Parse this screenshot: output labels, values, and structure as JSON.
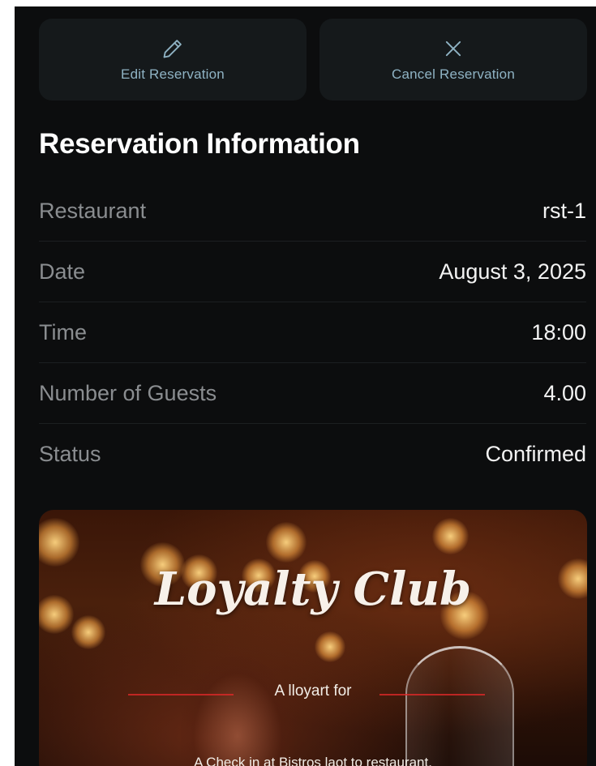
{
  "actions": {
    "edit": {
      "label": "Edit Reservation",
      "icon": "pencil-icon"
    },
    "cancel": {
      "label": "Cancel Reservation",
      "icon": "close-icon"
    }
  },
  "reservation": {
    "title": "Reservation Information",
    "rows": [
      {
        "label": "Restaurant",
        "value": "rst-1"
      },
      {
        "label": "Date",
        "value": "August 3, 2025"
      },
      {
        "label": "Time",
        "value": "18:00"
      },
      {
        "label": "Number of Guests",
        "value": "4.00"
      },
      {
        "label": "Status",
        "value": "Confirmed"
      }
    ]
  },
  "promo": {
    "title": "Loyalty Club",
    "subtitle": "A lloyart for",
    "text": "A Check in at Bistros laot to restaurant."
  },
  "colors": {
    "background": "#0c0d0e",
    "button_bg": "#15191b",
    "accent": "#8fb3c4",
    "label": "#8a8d90",
    "value": "#f3f3f3"
  }
}
